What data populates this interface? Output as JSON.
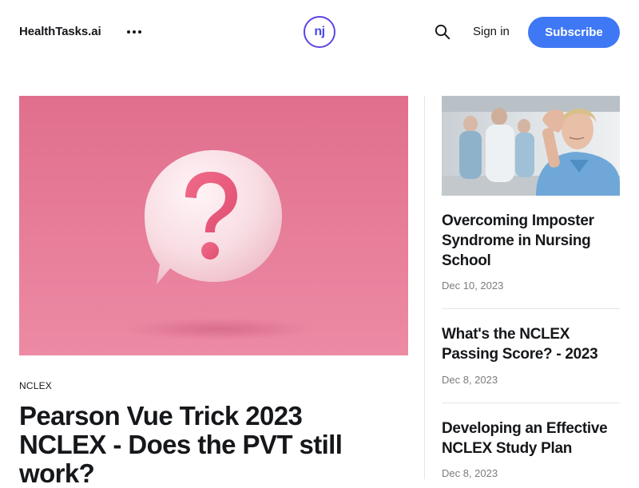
{
  "header": {
    "brand": "HealthTasks.ai",
    "logo_text": "nj",
    "signin_label": "Sign in",
    "subscribe_label": "Subscribe",
    "icons": {
      "more": "more-dots-icon",
      "search": "search-icon"
    }
  },
  "featured": {
    "tag": "NCLEX",
    "title": "Pearson Vue Trick 2023 NCLEX - Does the PVT still work?",
    "image": "question-mark-speech-bubble"
  },
  "sidebar": {
    "posts": [
      {
        "title": "Overcoming Imposter Syndrome in Nursing School",
        "date": "Dec 10, 2023",
        "image": "stressed-nurse-hospital-corridor"
      },
      {
        "title": "What's the NCLEX Passing Score? - 2023",
        "date": "Dec 8, 2023"
      },
      {
        "title": "Developing an Effective NCLEX Study Plan",
        "date": "Dec 8, 2023"
      }
    ]
  },
  "colors": {
    "accent": "#3f78f5",
    "logo": "#4a48e8",
    "feature_background": "#e87a98",
    "text": "#15171a",
    "muted": "#7c7c7c"
  }
}
